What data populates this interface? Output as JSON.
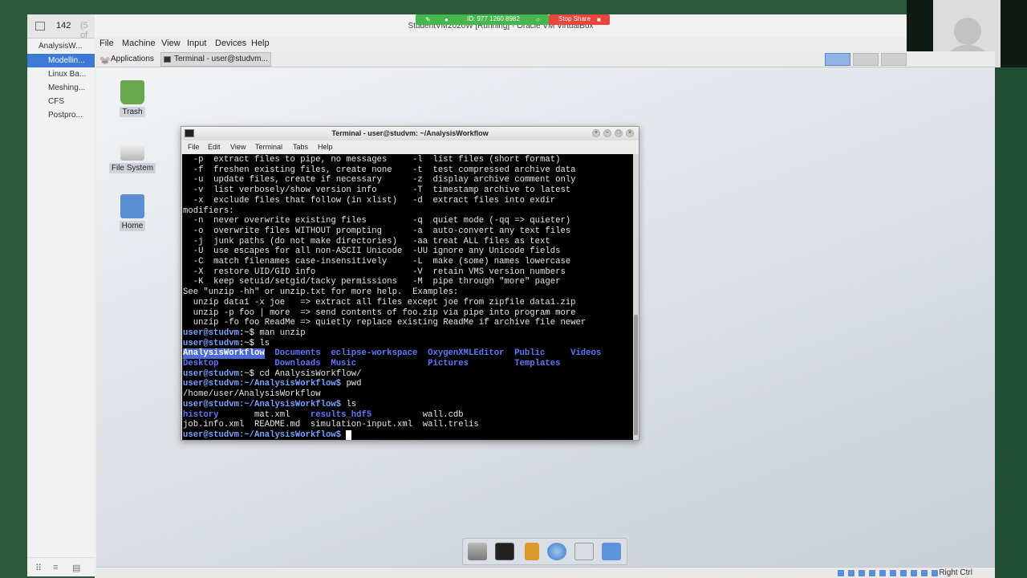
{
  "host": {
    "page_number": "142",
    "page_total": "(5 of",
    "tree": [
      "AnalysisW...",
      "Modellin...",
      "Linux Ba...",
      "Meshing...",
      "CFS",
      "Postpro..."
    ],
    "tree_selected": 1
  },
  "share": {
    "id_text": "ID: 977 1260 8982",
    "stop_label": "Stop Share"
  },
  "vbox": {
    "title": "StudentVM2020W [Running] - Oracle VM VirtualBox",
    "menu": [
      "File",
      "Machine",
      "View",
      "Input",
      "Devices",
      "Help"
    ],
    "host_key": "Right Ctrl"
  },
  "guest_panel": {
    "applications_label": "Applications",
    "task_label": "Terminal - user@studvm..."
  },
  "desktop_icons": [
    "Trash",
    "File System",
    "Home"
  ],
  "terminal": {
    "title": "Terminal - user@studvm: ~/AnalysisWorkflow",
    "menu": [
      "File",
      "Edit",
      "View",
      "Terminal",
      "Tabs",
      "Help"
    ],
    "lines": [
      "  -p  extract files to pipe, no messages     -l  list files (short format)",
      "  -f  freshen existing files, create none    -t  test compressed archive data",
      "  -u  update files, create if necessary      -z  display archive comment only",
      "  -v  list verbosely/show version info       -T  timestamp archive to latest",
      "  -x  exclude files that follow (in xlist)   -d  extract files into exdir",
      "modifiers:",
      "  -n  never overwrite existing files         -q  quiet mode (-qq => quieter)",
      "  -o  overwrite files WITHOUT prompting      -a  auto-convert any text files",
      "  -j  junk paths (do not make directories)   -aa treat ALL files as text",
      "  -U  use escapes for all non-ASCII Unicode  -UU ignore any Unicode fields",
      "  -C  match filenames case-insensitively     -L  make (some) names lowercase",
      "  -X  restore UID/GID info                   -V  retain VMS version numbers",
      "  -K  keep setuid/setgid/tacky permissions   -M  pipe through \"more\" pager",
      "See \"unzip -hh\" or unzip.txt for more help.  Examples:",
      "  unzip data1 -x joe   => extract all files except joe from zipfile data1.zip",
      "  unzip -p foo | more  => send contents of foo.zip via pipe into program more",
      "  unzip -fo foo ReadMe => quietly replace existing ReadMe if archive file newer"
    ],
    "prompt_user": "user@studvm",
    "prompt_home": ":~$ ",
    "prompt_aw": ":~/AnalysisWorkflow$ ",
    "cmd_man": "man unzip",
    "cmd_ls": "ls",
    "cmd_cd": "cd AnalysisWorkflow/",
    "cmd_pwd": "pwd",
    "home_ls_row1": {
      "a": "AnalysisWorkflow",
      "b": "Documents",
      "c": "eclipse-workspace",
      "d": "OxygenXMLEditor",
      "e": "Public",
      "f": "Videos"
    },
    "home_ls_row2": {
      "a": "Desktop",
      "b": "Downloads",
      "c": "Music",
      "d": "Pictures",
      "e": "Templates"
    },
    "pwd_output": "/home/user/AnalysisWorkflow",
    "aw_ls_row1": {
      "a": "history",
      "b": "mat.xml",
      "c": "results_hdf5",
      "d": "wall.cdb"
    },
    "aw_ls_row2": {
      "a": "job.info.xml",
      "b": "README.md",
      "c": "simulation-input.xml",
      "d": "wall.trelis"
    }
  },
  "dock_items": [
    "drive-icon",
    "terminal-icon",
    "file-manager-icon",
    "browser-icon",
    "search-icon",
    "folder-icon"
  ],
  "colors": {
    "selection": "#3d7ad6",
    "prompt": "#7aa3ff",
    "directory": "#5c78ff",
    "share_green": "#44b84c",
    "share_red": "#e8453c"
  }
}
